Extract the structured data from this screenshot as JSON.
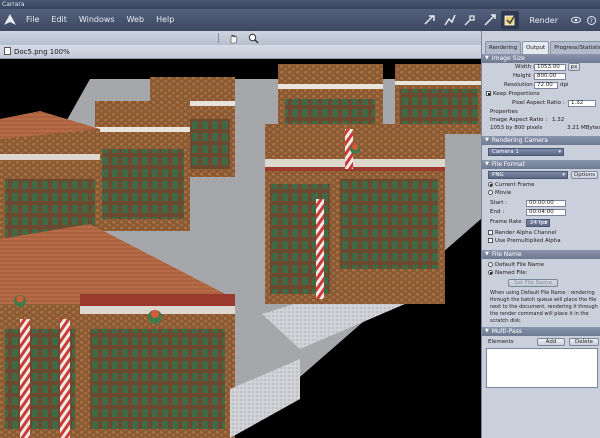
{
  "window": {
    "title": "Carrara"
  },
  "menu": {
    "items": [
      {
        "label": "File"
      },
      {
        "label": "Edit"
      },
      {
        "label": "Windows"
      },
      {
        "label": "Web"
      },
      {
        "label": "Help"
      }
    ],
    "room_label": "Render"
  },
  "document": {
    "title": "Doc5.png 100%"
  },
  "panel": {
    "tabs": [
      {
        "label": "Rendering",
        "active": false
      },
      {
        "label": "Output",
        "active": true
      },
      {
        "label": "Progress/Statistics",
        "active": false
      }
    ],
    "image_size": {
      "header": "Image Size",
      "width_label": "Width :",
      "width_value": "1053.00",
      "width_unit": "px",
      "height_label": "Height :",
      "height_value": "800.00",
      "resolution_label": "Resolution :",
      "resolution_value": "72.00",
      "resolution_unit": "dpi",
      "keep_proportions": "Keep Proportions",
      "pixel_aspect_label": "Pixel Aspect Ratio :",
      "pixel_aspect_value": "1.32",
      "properties_label": "Properties",
      "image_aspect_label": "Image Aspect Ratio :",
      "image_aspect_value": "1.32",
      "pixels_label": "1053 by 800 pixels",
      "mbytes_label": "3.21 MBytes"
    },
    "camera": {
      "header": "Rendering Camera",
      "selected": "Camera 1"
    },
    "file_format": {
      "header": "File Format",
      "format": "PNG",
      "options_label": "Options",
      "current_frame": "Current Frame",
      "movie": "Movie",
      "start_label": "Start :",
      "start_value": "00:00:00",
      "end_label": "End :",
      "end_value": "00:04:00",
      "frame_rate_label": "Frame Rate :",
      "frame_rate_value": "24 fps",
      "alpha_label": "Render Alpha Channel",
      "premult_label": "Use Premultiplied Alpha"
    },
    "file_name": {
      "header": "File Name",
      "default_label": "Default File Name",
      "named_label": "Named File:",
      "set_button": "Set File Name",
      "note": "When using Default File Name : rendering through the batch queue will place the file next to the document, rendering it through the render command will place it in the scratch disk."
    },
    "multi_pass": {
      "header": "Multi-Pass",
      "elements_label": "Elements",
      "add_label": "Add",
      "delete_label": "Delete"
    }
  },
  "icons": {
    "logo": "carrara-logo-icon",
    "hand": "hand-tool-icon",
    "zoom": "zoom-tool-icon",
    "doc": "document-icon",
    "rooms": [
      "assemble-room-icon",
      "model-room-icon",
      "storyboard-room-icon",
      "texture-room-icon",
      "render-room-icon"
    ]
  },
  "colors": {
    "menubar": "#4a5670",
    "section_header": "#7a86a0",
    "panel_bg": "#c9cfdb",
    "viewport_bg": "#000000",
    "ground": "#a7a9ad"
  }
}
